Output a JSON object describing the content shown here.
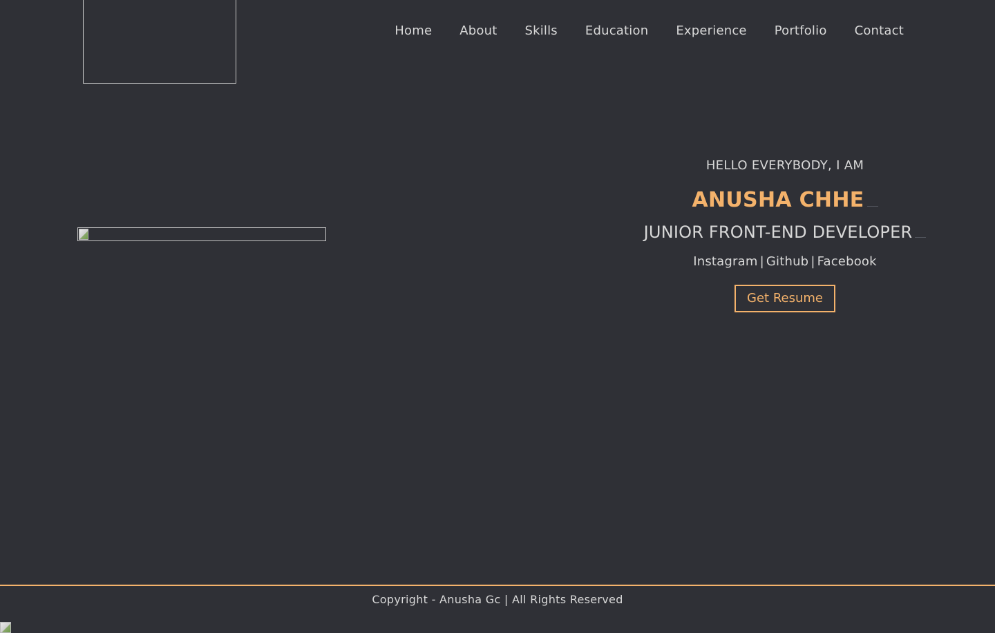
{
  "nav": {
    "items": [
      {
        "label": "Home"
      },
      {
        "label": "About"
      },
      {
        "label": "Skills"
      },
      {
        "label": "Education"
      },
      {
        "label": "Experience"
      },
      {
        "label": "Portfolio"
      },
      {
        "label": "Contact"
      }
    ]
  },
  "hero": {
    "greeting": "HELLO EVERYBODY, I AM",
    "name": "ANUSHA CHHE",
    "role": "JUNIOR FRONT-END DEVELOPER",
    "socials": [
      {
        "label": "Instagram"
      },
      {
        "label": "Github"
      },
      {
        "label": "Facebook"
      }
    ],
    "separator": "|",
    "resume_button": "Get Resume"
  },
  "footer": {
    "copyright": "Copyright - Anusha Gc | All Rights Reserved"
  },
  "colors": {
    "background": "#2f3036",
    "accent": "#f4b26b",
    "text": "#d8d8d8"
  }
}
